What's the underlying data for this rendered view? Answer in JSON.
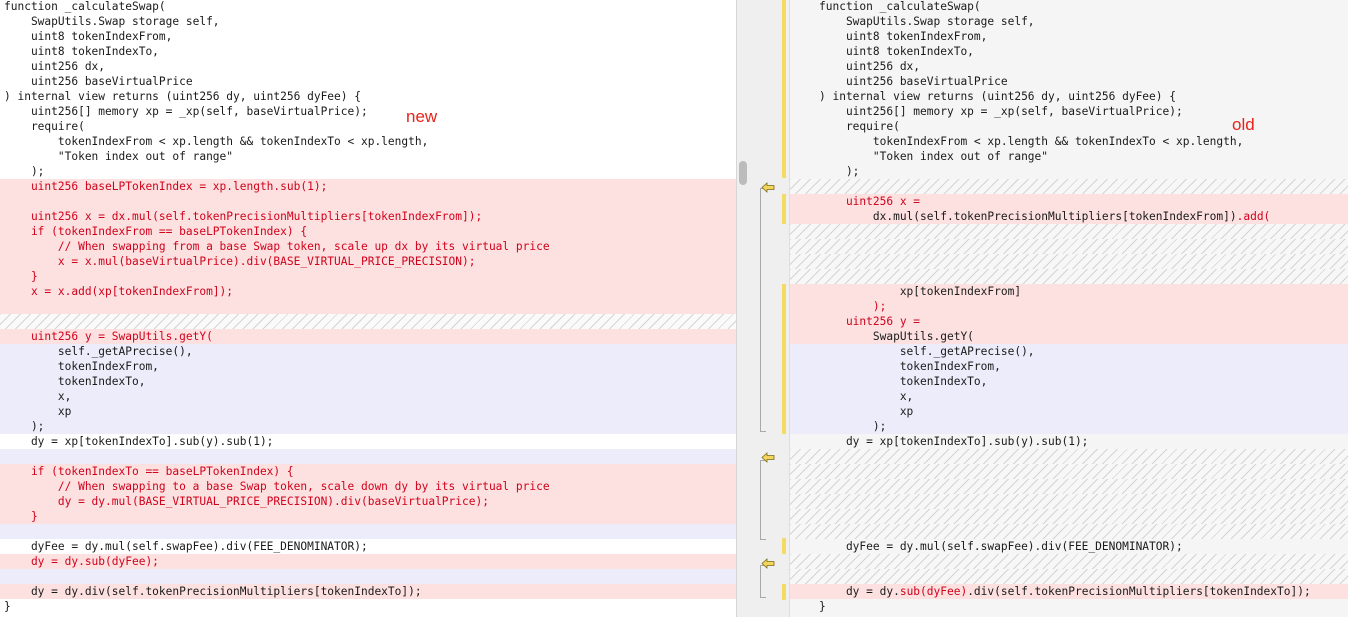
{
  "labels": {
    "new": "new",
    "old": "old"
  },
  "left": {
    "lines": [
      {
        "text": "function _calculateSwap(",
        "cls": ""
      },
      {
        "text": "    SwapUtils.Swap storage self,",
        "cls": ""
      },
      {
        "text": "    uint8 tokenIndexFrom,",
        "cls": ""
      },
      {
        "text": "    uint8 tokenIndexTo,",
        "cls": ""
      },
      {
        "text": "    uint256 dx,",
        "cls": ""
      },
      {
        "text": "    uint256 baseVirtualPrice",
        "cls": ""
      },
      {
        "text": ") internal view returns (uint256 dy, uint256 dyFee) {",
        "cls": ""
      },
      {
        "text": "    uint256[] memory xp = _xp(self, baseVirtualPrice);",
        "cls": ""
      },
      {
        "text": "    require(",
        "cls": ""
      },
      {
        "text": "        tokenIndexFrom < xp.length && tokenIndexTo < xp.length,",
        "cls": ""
      },
      {
        "text": "        \"Token index out of range\"",
        "cls": ""
      },
      {
        "text": "    );",
        "cls": ""
      },
      {
        "text": "    uint256 baseLPTokenIndex = xp.length.sub(1);",
        "cls": "del red"
      },
      {
        "text": "",
        "cls": "del"
      },
      {
        "text": "    uint256 x = dx.mul(self.tokenPrecisionMultipliers[tokenIndexFrom]);",
        "cls": "del red"
      },
      {
        "text": "    if (tokenIndexFrom == baseLPTokenIndex) {",
        "cls": "del red"
      },
      {
        "text": "        // When swapping from a base Swap token, scale up dx by its virtual price",
        "cls": "del red"
      },
      {
        "text": "        x = x.mul(baseVirtualPrice).div(BASE_VIRTUAL_PRICE_PRECISION);",
        "cls": "del red"
      },
      {
        "text": "    }",
        "cls": "del red"
      },
      {
        "text": "    x = x.add(xp[tokenIndexFrom]);",
        "cls": "del red"
      },
      {
        "text": "",
        "cls": "del"
      },
      {
        "text": "",
        "cls": "hatch"
      },
      {
        "text": "    uint256 y = SwapUtils.getY(",
        "cls": "del red"
      },
      {
        "text": "        self._getAPrecise(),",
        "cls": "chg"
      },
      {
        "text": "        tokenIndexFrom,",
        "cls": "chg"
      },
      {
        "text": "        tokenIndexTo,",
        "cls": "chg"
      },
      {
        "text": "        x,",
        "cls": "chg"
      },
      {
        "text": "        xp",
        "cls": "chg"
      },
      {
        "text": "    );",
        "cls": "chg"
      },
      {
        "text": "    dy = xp[tokenIndexTo].sub(y).sub(1);",
        "cls": ""
      },
      {
        "text": "",
        "cls": "chg"
      },
      {
        "text": "    if (tokenIndexTo == baseLPTokenIndex) {",
        "cls": "del red"
      },
      {
        "text": "        // When swapping to a base Swap token, scale down dy by its virtual price",
        "cls": "del red"
      },
      {
        "text": "        dy = dy.mul(BASE_VIRTUAL_PRICE_PRECISION).div(baseVirtualPrice);",
        "cls": "del red"
      },
      {
        "text": "    }",
        "cls": "del red"
      },
      {
        "text": "",
        "cls": "chg"
      },
      {
        "text": "    dyFee = dy.mul(self.swapFee).div(FEE_DENOMINATOR);",
        "cls": ""
      },
      {
        "text": "    dy = dy.sub(dyFee);",
        "cls": "del red"
      },
      {
        "text": "",
        "cls": "chg"
      },
      {
        "text": "    dy = dy.div(self.tokenPrecisionMultipliers[tokenIndexTo]);",
        "cls": "del"
      },
      {
        "text": "}",
        "cls": ""
      }
    ]
  },
  "right": {
    "lines": [
      {
        "segs": [
          {
            "t": "function _calculateSwap(",
            "c": ""
          }
        ],
        "cls": ""
      },
      {
        "segs": [
          {
            "t": "    SwapUtils.Swap storage self,",
            "c": ""
          }
        ],
        "cls": ""
      },
      {
        "segs": [
          {
            "t": "    uint8 tokenIndexFrom,",
            "c": ""
          }
        ],
        "cls": ""
      },
      {
        "segs": [
          {
            "t": "    uint8 tokenIndexTo,",
            "c": ""
          }
        ],
        "cls": ""
      },
      {
        "segs": [
          {
            "t": "    uint256 dx,",
            "c": ""
          }
        ],
        "cls": ""
      },
      {
        "segs": [
          {
            "t": "    uint256 baseVirtualPrice",
            "c": ""
          }
        ],
        "cls": ""
      },
      {
        "segs": [
          {
            "t": ") internal view returns (uint256 dy, uint256 dyFee) {",
            "c": ""
          }
        ],
        "cls": ""
      },
      {
        "segs": [
          {
            "t": "    uint256[] memory xp = _xp(self, baseVirtualPrice);",
            "c": ""
          }
        ],
        "cls": ""
      },
      {
        "segs": [
          {
            "t": "    require(",
            "c": ""
          }
        ],
        "cls": ""
      },
      {
        "segs": [
          {
            "t": "        tokenIndexFrom < xp.length && tokenIndexTo < xp.length,",
            "c": ""
          }
        ],
        "cls": ""
      },
      {
        "segs": [
          {
            "t": "        \"Token index out of range\"",
            "c": ""
          }
        ],
        "cls": ""
      },
      {
        "segs": [
          {
            "t": "    );",
            "c": ""
          }
        ],
        "cls": ""
      },
      {
        "segs": [],
        "cls": "hatch"
      },
      {
        "segs": [
          {
            "t": "    uint256 x =",
            "c": "red"
          }
        ],
        "cls": "del"
      },
      {
        "segs": [
          {
            "t": "        dx.mul(self.tokenPrecisionMultipliers[tokenIndexFrom])",
            "c": ""
          },
          {
            "t": ".add(",
            "c": "red"
          }
        ],
        "cls": "del"
      },
      {
        "segs": [],
        "cls": "hatch"
      },
      {
        "segs": [],
        "cls": "hatch"
      },
      {
        "segs": [],
        "cls": "hatch"
      },
      {
        "segs": [],
        "cls": "hatch"
      },
      {
        "segs": [
          {
            "t": "            xp[tokenIndexFrom]",
            "c": ""
          }
        ],
        "cls": "del"
      },
      {
        "segs": [
          {
            "t": "        );",
            "c": "red"
          }
        ],
        "cls": "del"
      },
      {
        "segs": [
          {
            "t": "    uint256 y =",
            "c": "red"
          }
        ],
        "cls": "del"
      },
      {
        "segs": [
          {
            "t": "        SwapUtils.getY(",
            "c": ""
          }
        ],
        "cls": "del"
      },
      {
        "segs": [
          {
            "t": "            self._getAPrecise(),",
            "c": ""
          }
        ],
        "cls": "chg"
      },
      {
        "segs": [
          {
            "t": "            tokenIndexFrom,",
            "c": ""
          }
        ],
        "cls": "chg"
      },
      {
        "segs": [
          {
            "t": "            tokenIndexTo,",
            "c": ""
          }
        ],
        "cls": "chg"
      },
      {
        "segs": [
          {
            "t": "            x,",
            "c": ""
          }
        ],
        "cls": "chg"
      },
      {
        "segs": [
          {
            "t": "            xp",
            "c": ""
          }
        ],
        "cls": "chg"
      },
      {
        "segs": [
          {
            "t": "        );",
            "c": ""
          }
        ],
        "cls": "chg"
      },
      {
        "segs": [
          {
            "t": "    dy = xp[tokenIndexTo].sub(y).sub(1);",
            "c": ""
          }
        ],
        "cls": ""
      },
      {
        "segs": [],
        "cls": "hatch"
      },
      {
        "segs": [],
        "cls": "hatch"
      },
      {
        "segs": [],
        "cls": "hatch"
      },
      {
        "segs": [],
        "cls": "hatch"
      },
      {
        "segs": [],
        "cls": "hatch"
      },
      {
        "segs": [],
        "cls": "hatch"
      },
      {
        "segs": [
          {
            "t": "    dyFee = dy.mul(self.swapFee).div(FEE_DENOMINATOR);",
            "c": ""
          }
        ],
        "cls": ""
      },
      {
        "segs": [],
        "cls": "hatch"
      },
      {
        "segs": [],
        "cls": "hatch"
      },
      {
        "segs": [
          {
            "t": "    dy = dy.",
            "c": ""
          },
          {
            "t": "sub(dyFee)",
            "c": "red"
          },
          {
            "t": ".div(self.tokenPrecisionMultipliers[tokenIndexTo]);",
            "c": ""
          }
        ],
        "cls": "del"
      },
      {
        "segs": [
          {
            "t": "}",
            "c": ""
          }
        ],
        "cls": ""
      }
    ]
  }
}
